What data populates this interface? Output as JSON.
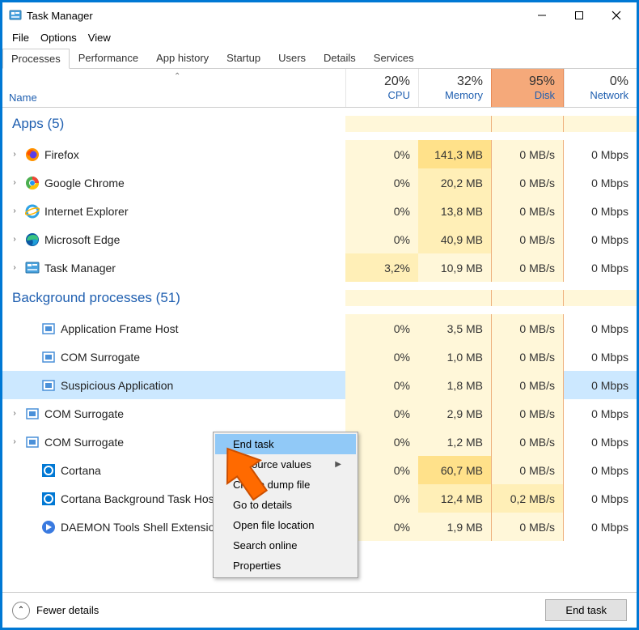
{
  "window": {
    "title": "Task Manager"
  },
  "menu": {
    "file": "File",
    "options": "Options",
    "view": "View"
  },
  "tabs": {
    "processes": "Processes",
    "performance": "Performance",
    "apphistory": "App history",
    "startup": "Startup",
    "users": "Users",
    "details": "Details",
    "services": "Services"
  },
  "columns": {
    "name": "Name",
    "cpu": {
      "pct": "20%",
      "label": "CPU"
    },
    "memory": {
      "pct": "32%",
      "label": "Memory"
    },
    "disk": {
      "pct": "95%",
      "label": "Disk"
    },
    "network": {
      "pct": "0%",
      "label": "Network"
    }
  },
  "groups": {
    "apps": "Apps (5)",
    "background": "Background processes (51)"
  },
  "apps": [
    {
      "name": "Firefox",
      "cpu": "0%",
      "mem": "141,3 MB",
      "disk": "0 MB/s",
      "net": "0 Mbps",
      "icon": "firefox"
    },
    {
      "name": "Google Chrome",
      "cpu": "0%",
      "mem": "20,2 MB",
      "disk": "0 MB/s",
      "net": "0 Mbps",
      "icon": "chrome"
    },
    {
      "name": "Internet Explorer",
      "cpu": "0%",
      "mem": "13,8 MB",
      "disk": "0 MB/s",
      "net": "0 Mbps",
      "icon": "ie"
    },
    {
      "name": "Microsoft Edge",
      "cpu": "0%",
      "mem": "40,9 MB",
      "disk": "0 MB/s",
      "net": "0 Mbps",
      "icon": "edge"
    },
    {
      "name": "Task Manager",
      "cpu": "3,2%",
      "mem": "10,9 MB",
      "disk": "0 MB/s",
      "net": "0 Mbps",
      "icon": "tm"
    }
  ],
  "bg": [
    {
      "name": "Application Frame Host",
      "cpu": "0%",
      "mem": "3,5 MB",
      "disk": "0 MB/s",
      "net": "0 Mbps",
      "icon": "frame",
      "expand": false
    },
    {
      "name": "COM Surrogate",
      "cpu": "0%",
      "mem": "1,0 MB",
      "disk": "0 MB/s",
      "net": "0 Mbps",
      "icon": "frame",
      "expand": false
    },
    {
      "name": "Suspicious Application",
      "cpu": "0%",
      "mem": "1,8 MB",
      "disk": "0 MB/s",
      "net": "0 Mbps",
      "icon": "frame",
      "expand": false,
      "selected": true
    },
    {
      "name": "COM Surrogate",
      "cpu": "0%",
      "mem": "2,9 MB",
      "disk": "0 MB/s",
      "net": "0 Mbps",
      "icon": "frame",
      "expand": true
    },
    {
      "name": "COM Surrogate",
      "cpu": "0%",
      "mem": "1,2 MB",
      "disk": "0 MB/s",
      "net": "0 Mbps",
      "icon": "frame",
      "expand": true
    },
    {
      "name": "Cortana",
      "cpu": "0%",
      "mem": "60,7 MB",
      "disk": "0 MB/s",
      "net": "0 Mbps",
      "icon": "cortana",
      "expand": false
    },
    {
      "name": "Cortana Background Task Host",
      "cpu": "0%",
      "mem": "12,4 MB",
      "disk": "0,2 MB/s",
      "net": "0 Mbps",
      "icon": "cortana",
      "expand": false,
      "diskhot": true
    },
    {
      "name": "DAEMON Tools Shell Extensions",
      "cpu": "0%",
      "mem": "1,9 MB",
      "disk": "0 MB/s",
      "net": "0 Mbps",
      "icon": "daemon",
      "expand": false
    }
  ],
  "context_menu": {
    "end_task": "End task",
    "resource_values": "Resource values",
    "create_dump": "Create dump file",
    "go_to_details": "Go to details",
    "open_file_location": "Open file location",
    "search_online": "Search online",
    "properties": "Properties"
  },
  "footer": {
    "fewer": "Fewer details",
    "end_task": "End task"
  }
}
